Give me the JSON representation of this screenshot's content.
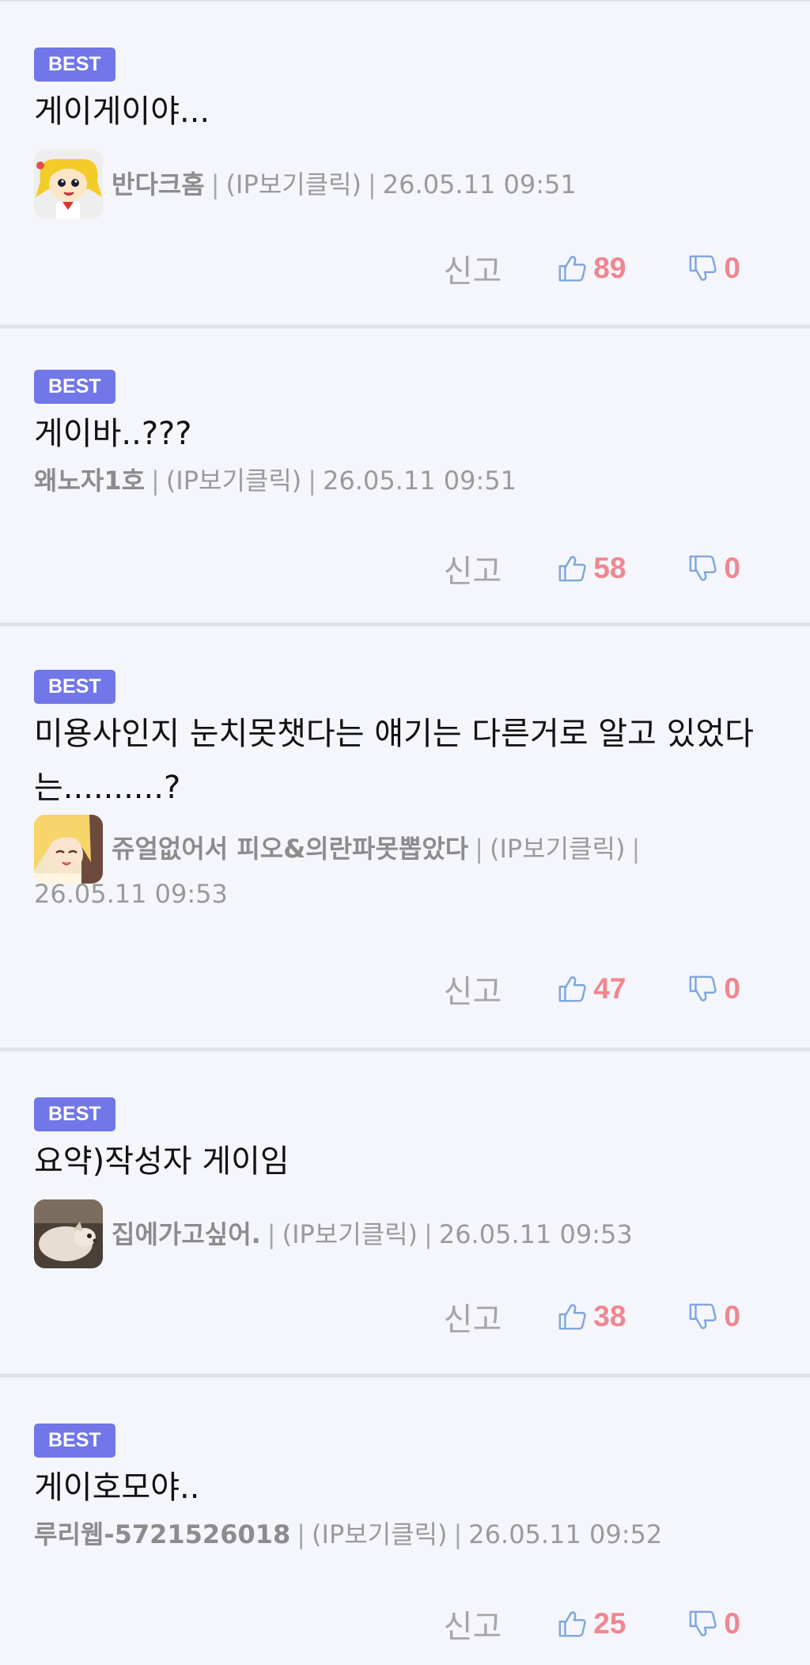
{
  "labels": {
    "best": "BEST",
    "report": "신고",
    "ip_click": "(IP보기클릭)",
    "separator": "|"
  },
  "colors": {
    "badge": "#7176e8",
    "vote_count": "#f0868f",
    "thumb_icon": "#7fa7dd",
    "meta_text": "#9a9a9a"
  },
  "comments": [
    {
      "text": "게이게이야...",
      "author": "반다크홈",
      "avatar": "avatar-cartoon-girl-yellow-hair",
      "datetime": "26.05.11 09:51",
      "likes": "89",
      "dislikes": "0"
    },
    {
      "text": "게이바..???",
      "author": "왜노자1호",
      "avatar": "",
      "datetime": "26.05.11 09:51",
      "likes": "58",
      "dislikes": "0"
    },
    {
      "text": "미용사인지 눈치못챗다는 얘기는 다른거로 알고 있었다는..........?",
      "author": "쥬얼없어서 피오&의란파못뽑았다",
      "avatar": "avatar-anime-girl-blonde",
      "datetime": "26.05.11 09:53",
      "likes": "47",
      "dislikes": "0"
    },
    {
      "text": "요약)작성자 게이임",
      "author": "집에가고싶어.",
      "avatar": "avatar-dog-photo",
      "datetime": "26.05.11 09:53",
      "likes": "38",
      "dislikes": "0"
    },
    {
      "text": "게이호모야..",
      "author": "루리웹-5721526018",
      "avatar": "",
      "datetime": "26.05.11 09:52",
      "likes": "25",
      "dislikes": "0"
    }
  ]
}
